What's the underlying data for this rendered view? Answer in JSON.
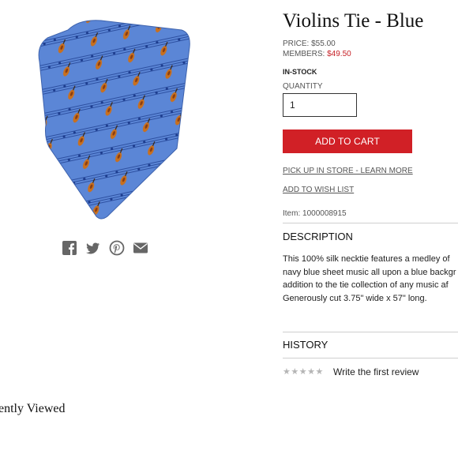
{
  "product": {
    "title": "Violins Tie - Blue",
    "price_label": "PRICE:",
    "price": "$55.00",
    "members_label": "MEMBERS:",
    "members_price": "$49.50",
    "stock": "IN-STOCK",
    "quantity_label": "QUANTITY",
    "quantity_value": "1",
    "add_to_cart": "ADD TO CART",
    "pickup_link": "PICK UP IN STORE - LEARN MORE",
    "wishlist_link": "ADD TO WISH LIST",
    "item_number": "Item: 1000008915"
  },
  "description": {
    "heading": "DESCRIPTION",
    "lines": [
      "This 100% silk necktie features a medley of",
      "navy blue sheet music all upon a blue backgr",
      "addition to the tie collection of any music af",
      "Generously cut 3.75\" wide x 57\" long."
    ]
  },
  "history": {
    "heading": "HISTORY",
    "stars": "★★★★★",
    "rating_value": 0,
    "review_link": "Write the first review"
  },
  "share": {
    "icons": [
      "facebook-icon",
      "twitter-icon",
      "pinterest-icon",
      "email-icon"
    ]
  },
  "recently_viewed": {
    "heading": "ently Viewed"
  },
  "colors": {
    "accent": "#d12026",
    "tie_blue": "#5b86d6",
    "icon_gray": "#666666"
  }
}
